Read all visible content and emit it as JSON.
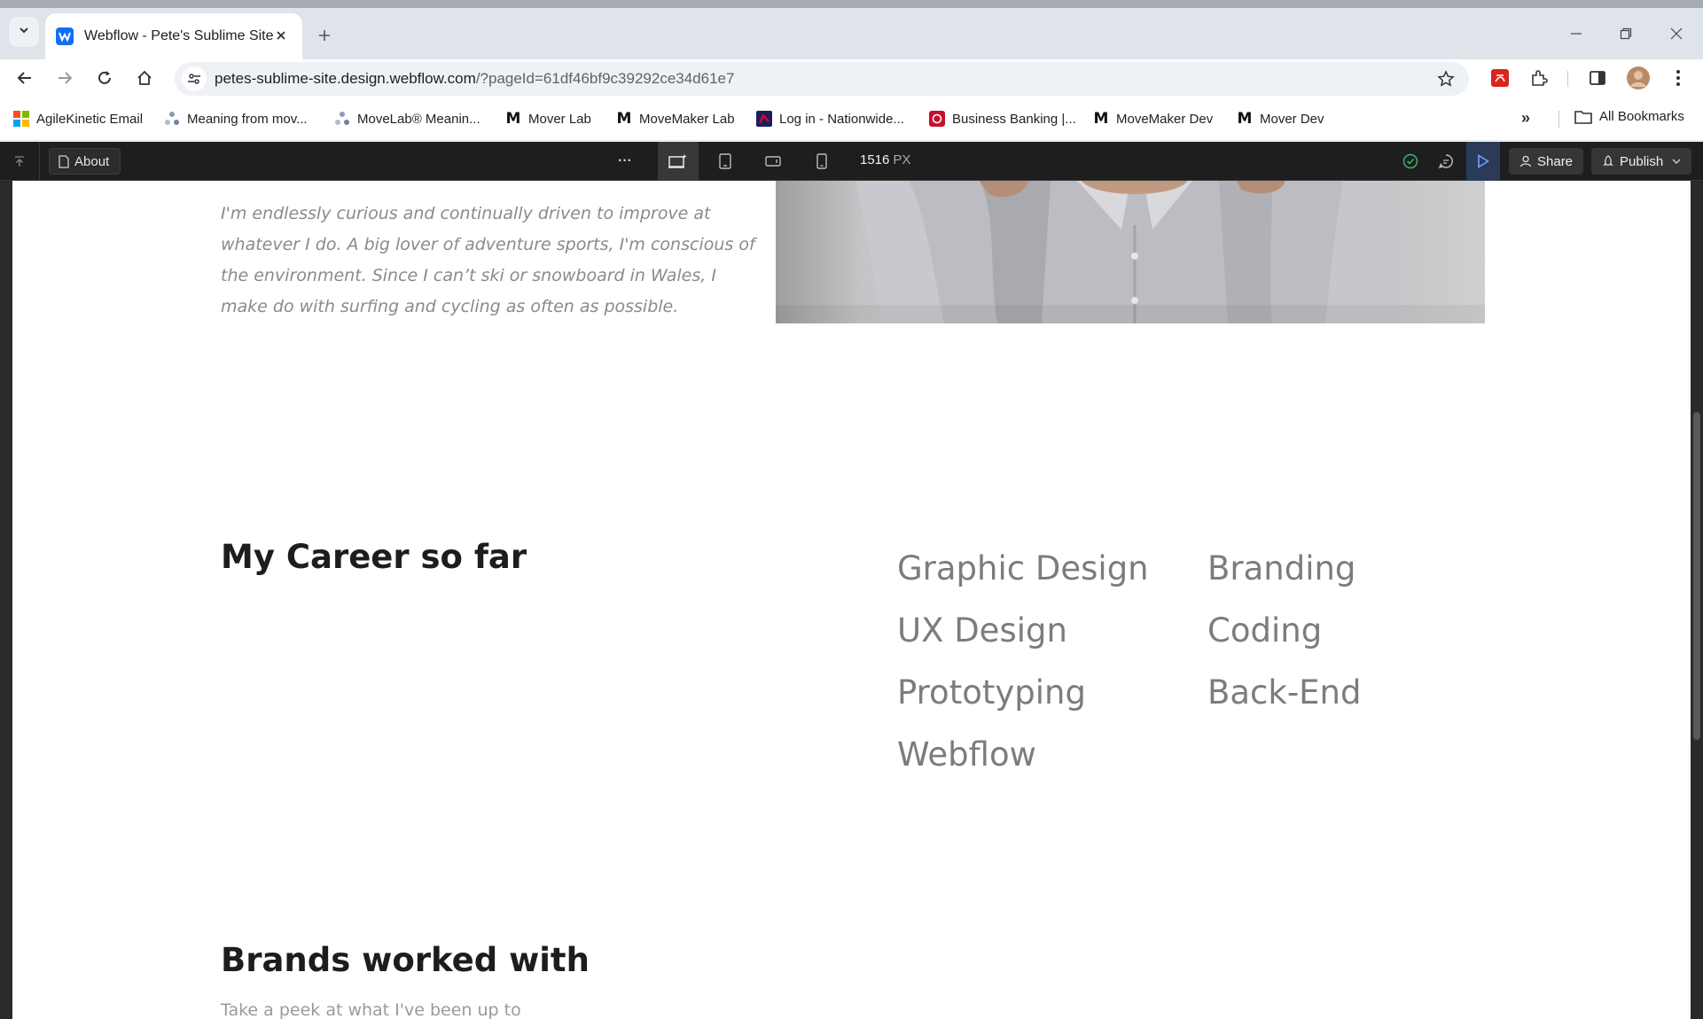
{
  "browser": {
    "tab": {
      "title": "Webflow - Pete's Sublime Site",
      "favicon": "W"
    },
    "address": {
      "host": "petes-sublime-site.design.webflow.com",
      "path": "/?pageId=61df46bf9c39292ce34d61e7"
    },
    "bookmarks": [
      {
        "label": "AgileKinetic Email",
        "icon": "microsoft-icon"
      },
      {
        "label": "Meaning from mov...",
        "icon": "movelab-icon"
      },
      {
        "label": "MoveLab® Meanin...",
        "icon": "movelab-icon"
      },
      {
        "label": "Mover Lab",
        "icon": "m-logo-icon"
      },
      {
        "label": "MoveMaker Lab",
        "icon": "m-logo-icon"
      },
      {
        "label": "Log in - Nationwide...",
        "icon": "nationwide-icon"
      },
      {
        "label": "Business Banking |...",
        "icon": "bank-icon"
      },
      {
        "label": "MoveMaker Dev",
        "icon": "m-logo-icon"
      },
      {
        "label": "Mover Dev",
        "icon": "m-logo-icon"
      }
    ],
    "all_bookmarks": "All Bookmarks",
    "more": "»"
  },
  "designer": {
    "page_name": "About",
    "canvas_width": "1516",
    "width_unit": "PX",
    "share_label": "Share",
    "publish_label": "Publish",
    "more": "···"
  },
  "site": {
    "intro": "I'm endlessly curious and continually driven to improve at whatever I do. A big lover of adventure sports, I'm conscious of the environment. Since I can’t ski or snowboard in Wales, I make do with surfing and cycling as often as possible.",
    "career_title": "My Career so far",
    "skills_left": [
      "Graphic Design",
      "UX Design",
      "Prototyping",
      "Webflow"
    ],
    "skills_right": [
      "Branding",
      "Coding",
      "Back-End"
    ],
    "brands_title": "Brands worked with",
    "brands_subtitle": "Take a peek at what I've been up to"
  }
}
